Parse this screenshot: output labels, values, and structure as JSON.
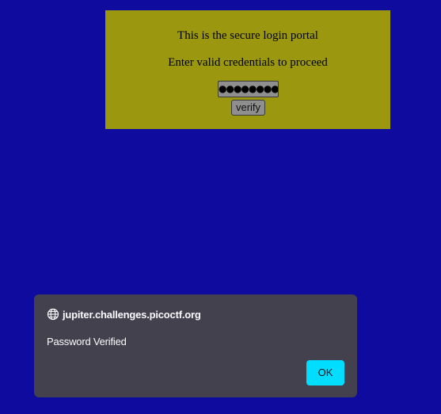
{
  "colors": {
    "page_background": "#0e0b9e",
    "login_box_background": "#9b9810",
    "dialog_background": "#42414d",
    "ok_button_background": "#00ddff"
  },
  "login": {
    "title": "This is the secure login portal",
    "instructions": "Enter valid credentials to proceed",
    "password_value": "●●●●●●●●●●●",
    "verify_label": "verify"
  },
  "dialog": {
    "icon": "globe-icon",
    "origin": "jupiter.challenges.picoctf.org",
    "message": "Password Verified",
    "ok_label": "OK"
  }
}
